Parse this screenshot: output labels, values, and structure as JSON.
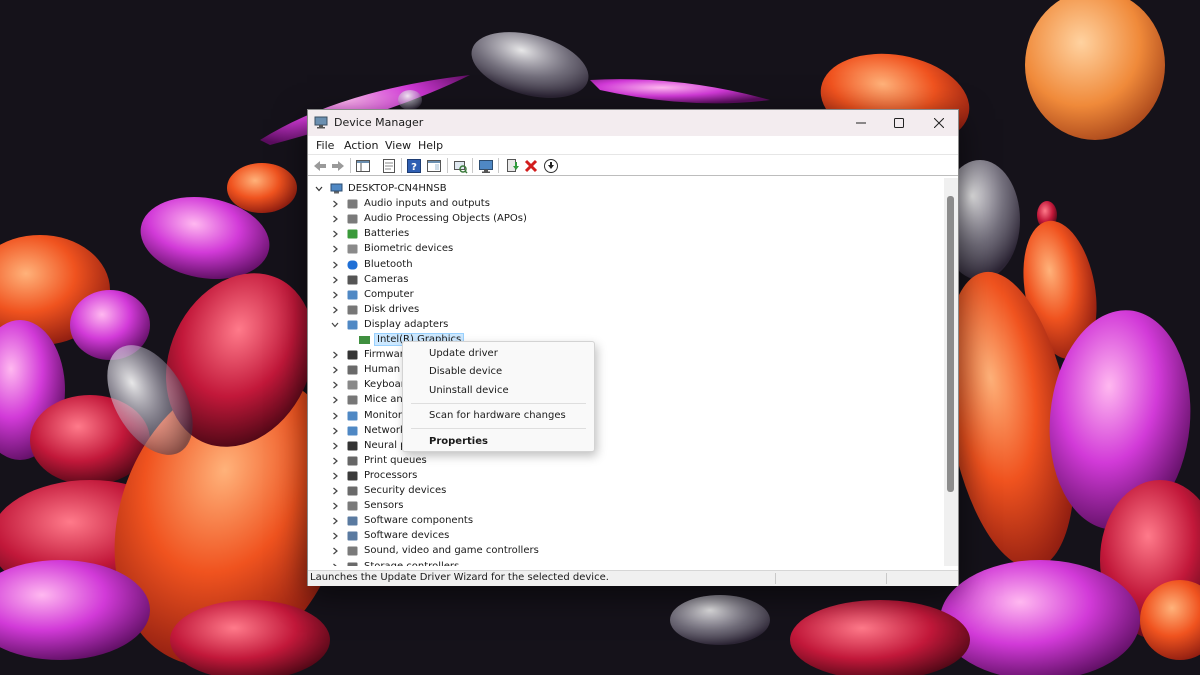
{
  "window": {
    "title": "Device Manager"
  },
  "menu": [
    "File",
    "Action",
    "View",
    "Help"
  ],
  "tree": {
    "root": "DESKTOP-CN4HNSB",
    "categories": [
      {
        "label": "Audio inputs and outputs",
        "icon": "speaker-icon"
      },
      {
        "label": "Audio Processing Objects (APOs)",
        "icon": "speaker-icon"
      },
      {
        "label": "Batteries",
        "icon": "battery-icon"
      },
      {
        "label": "Biometric devices",
        "icon": "fingerprint-icon"
      },
      {
        "label": "Bluetooth",
        "icon": "bluetooth-icon"
      },
      {
        "label": "Cameras",
        "icon": "camera-icon"
      },
      {
        "label": "Computer",
        "icon": "computer-icon"
      },
      {
        "label": "Disk drives",
        "icon": "disk-icon"
      },
      {
        "label": "Display adapters",
        "icon": "display-icon",
        "expanded": true
      },
      {
        "label": "Firmware",
        "icon": "chip-icon"
      },
      {
        "label": "Human I",
        "icon": "hid-icon"
      },
      {
        "label": "Keyboar",
        "icon": "keyboard-icon"
      },
      {
        "label": "Mice and",
        "icon": "mouse-icon"
      },
      {
        "label": "Monitor",
        "icon": "monitor-icon"
      },
      {
        "label": "Network",
        "icon": "network-icon"
      },
      {
        "label": "Neural p",
        "icon": "chip-icon"
      },
      {
        "label": "Print queues",
        "icon": "printer-icon"
      },
      {
        "label": "Processors",
        "icon": "processor-icon"
      },
      {
        "label": "Security devices",
        "icon": "security-icon"
      },
      {
        "label": "Sensors",
        "icon": "sensor-icon"
      },
      {
        "label": "Software components",
        "icon": "component-icon"
      },
      {
        "label": "Software devices",
        "icon": "component-icon"
      },
      {
        "label": "Sound, video and game controllers",
        "icon": "speaker-icon"
      },
      {
        "label": "Storage controllers",
        "icon": "storage-icon"
      }
    ],
    "child": {
      "label": "Intel(R) Graphics",
      "icon": "display-adapter-icon"
    }
  },
  "context_menu": {
    "update_driver": "Update driver",
    "disable_device": "Disable device",
    "uninstall_device": "Uninstall device",
    "scan_hardware": "Scan for hardware changes",
    "properties": "Properties"
  },
  "status": {
    "text": "Launches the Update Driver Wizard for the selected device."
  },
  "colors": {
    "selection": "#cce8ff",
    "titlebar": "#f3ecef",
    "desktop": "#15121a"
  }
}
